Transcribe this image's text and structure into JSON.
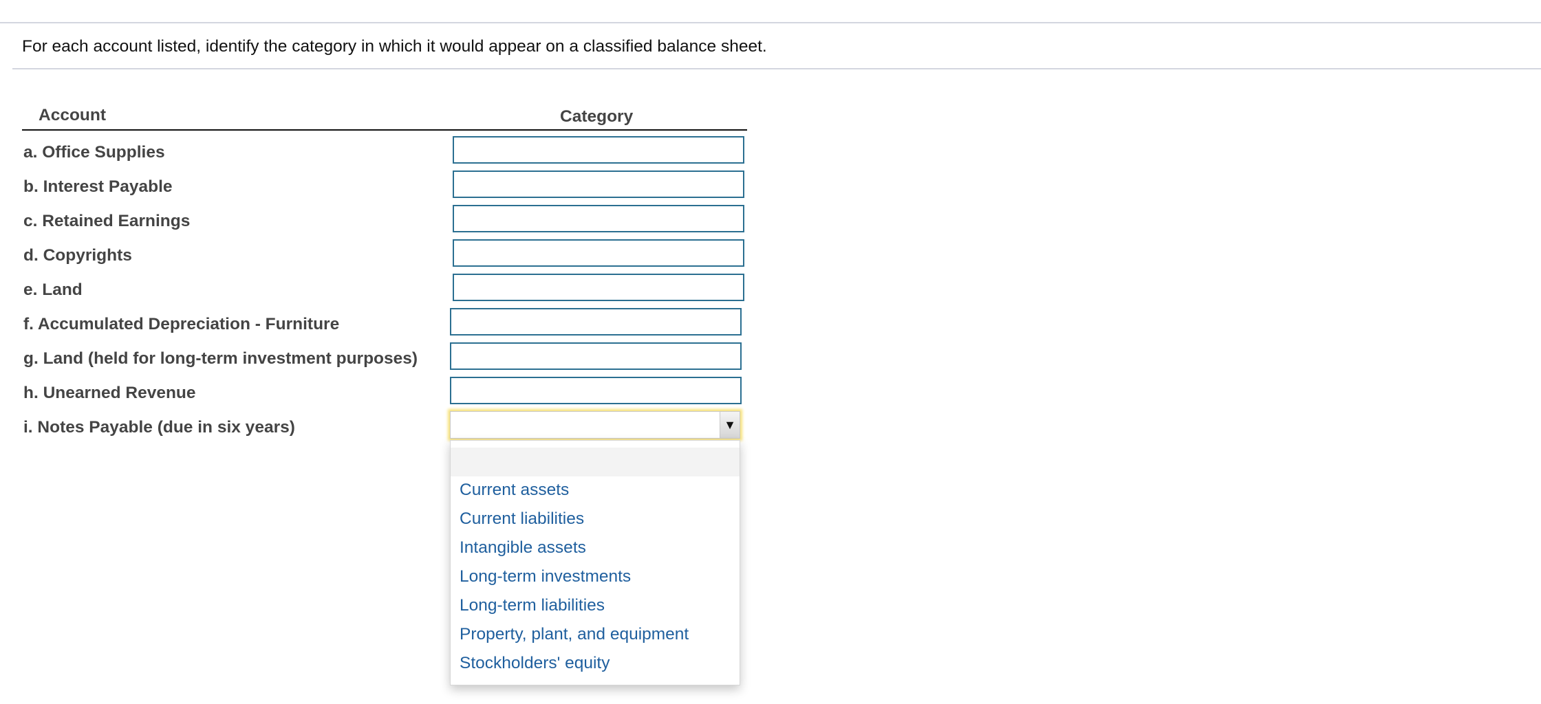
{
  "instruction": "For each account listed, identify the category in which it would appear on a classified balance sheet.",
  "table": {
    "headers": {
      "account": "Account",
      "category": "Category"
    },
    "rows": [
      {
        "label": "a. Office Supplies",
        "value": ""
      },
      {
        "label": "b. Interest Payable",
        "value": ""
      },
      {
        "label": "c. Retained Earnings",
        "value": ""
      },
      {
        "label": "d. Copyrights",
        "value": ""
      },
      {
        "label": "e. Land",
        "value": ""
      },
      {
        "label": "f. Accumulated Depreciation - Furniture",
        "value": ""
      },
      {
        "label": "g. Land (held for long-term investment purposes)",
        "value": ""
      },
      {
        "label": "h. Unearned Revenue",
        "value": ""
      },
      {
        "label": "i. Notes Payable (due in six years)",
        "value": ""
      }
    ]
  },
  "dropdown": {
    "arrow_icon": "▼",
    "blank_option": "",
    "options": [
      "Current assets",
      "Current liabilities",
      "Intangible assets",
      "Long-term investments",
      "Long-term liabilities",
      "Property, plant, and equipment",
      "Stockholders' equity"
    ]
  },
  "colors": {
    "input_border": "#2b6f91",
    "option_text": "#1f5f9e",
    "focus_glow": "#f7e27a",
    "label_text": "#444444"
  }
}
